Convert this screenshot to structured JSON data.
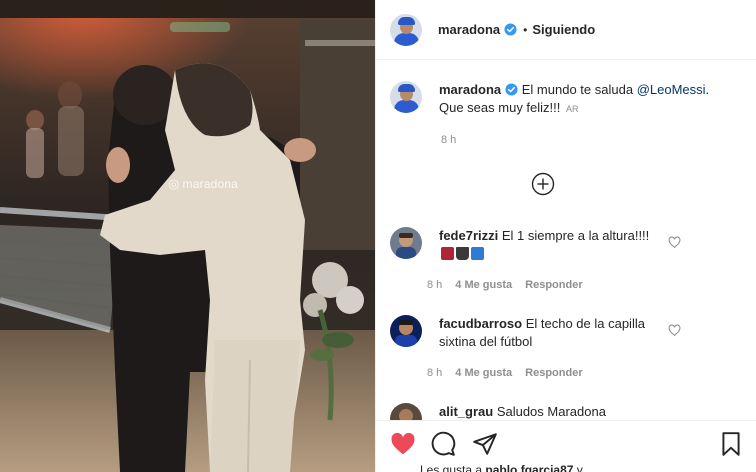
{
  "header": {
    "username": "maradona",
    "separator": "•",
    "follow_state": "Siguiendo"
  },
  "photo": {
    "watermark": "maradona"
  },
  "caption": {
    "username": "maradona",
    "text_pre": "El mundo te saluda",
    "mention": "@LeoMessi",
    "text_post": ". Que seas muy feliz!!!",
    "translate": "AR",
    "time": "8 h"
  },
  "comments": [
    {
      "username": "fede7rizzi",
      "text": "El 1 siempre a la altura!!!!",
      "time": "8 h",
      "likes": "4 Me gusta",
      "reply": "Responder"
    },
    {
      "username": "facudbarroso",
      "text": "El techo de la capilla sixtina del fútbol",
      "time": "8 h",
      "likes": "4 Me gusta",
      "reply": "Responder"
    },
    {
      "username": "alit_grau",
      "text": "Saludos Maradona",
      "time": "",
      "likes": "",
      "reply": ""
    }
  ],
  "footer": {
    "likes_prefix": "Les gusta a",
    "likes_user": "pablo.fgarcia87",
    "likes_suffix": "y"
  },
  "colors": {
    "like_red": "#ed4956",
    "verified_blue": "#3897f0",
    "mention_blue": "#00376b",
    "muted": "#8e8e8e"
  },
  "icons": {
    "like": "heart-filled-icon",
    "comment": "speech-bubble-icon",
    "share": "paper-plane-icon",
    "save": "bookmark-icon",
    "load_more": "plus-circle-icon"
  }
}
